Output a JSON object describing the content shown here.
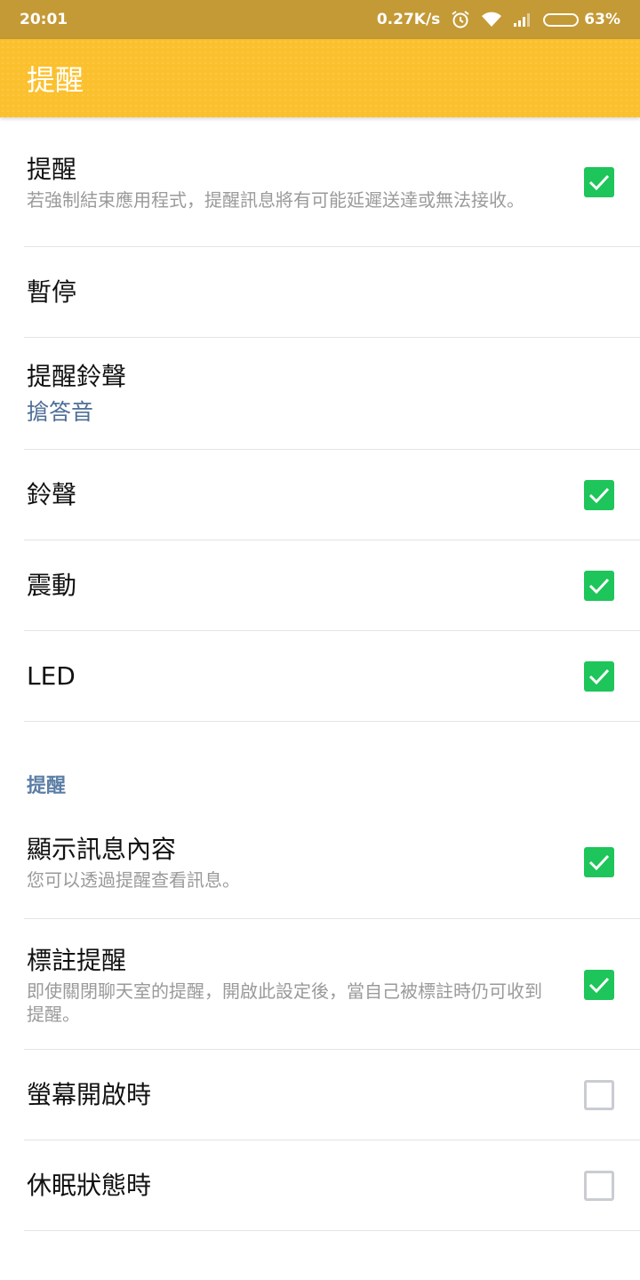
{
  "status_bar": {
    "time": "20:01",
    "speed": "0.27K/s",
    "battery": "63%",
    "battery_level": 0.63
  },
  "app_bar": {
    "title": "提醒"
  },
  "settings": [
    {
      "title": "提醒",
      "subtitle": "若強制結束應用程式，提醒訊息將有可能延遲送達或無法接收。",
      "checked": true
    },
    {
      "title": "暫停"
    },
    {
      "title": "提醒鈴聲",
      "value": "搶答音"
    },
    {
      "title": "鈴聲",
      "checked": true
    },
    {
      "title": "震動",
      "checked": true
    },
    {
      "title": "LED",
      "checked": true
    }
  ],
  "section": {
    "label": "提醒"
  },
  "settings2": [
    {
      "title": "顯示訊息內容",
      "subtitle": "您可以透過提醒查看訊息。",
      "checked": true
    },
    {
      "title": "標註提醒",
      "subtitle": "即使關閉聊天室的提醒，開啟此設定後，當自己被標註時仍可收到提醒。",
      "checked": true
    },
    {
      "title": "螢幕開啟時",
      "checked": false
    },
    {
      "title": "休眠狀態時",
      "checked": false
    }
  ],
  "colors": {
    "status_bar": "#c49a36",
    "app_bar": "#fbc02d",
    "check_on": "#1ec55a",
    "link": "#4e6e96"
  }
}
